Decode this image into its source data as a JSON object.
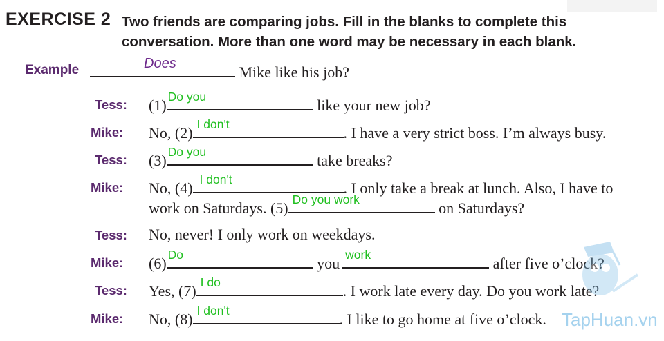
{
  "exercise": {
    "label": "EXERCISE 2",
    "instruction_line1": "Two friends are comparing jobs. Fill in the blanks to complete this",
    "instruction_line2": "conversation. More than one word may be necessary in each blank."
  },
  "example": {
    "label": "Example",
    "answer": "Does",
    "rest": "Mike like his job?"
  },
  "dialogue": [
    {
      "speaker": "Tess:",
      "num": "(1)",
      "answers": [
        "Do you"
      ],
      "after": "like your new job?"
    },
    {
      "speaker": "Mike:",
      "pre": "No,",
      "num": "(2)",
      "answers": [
        "I don't"
      ],
      "after": ". I have a very strict boss. I’m always busy."
    },
    {
      "speaker": "Tess:",
      "num": "(3)",
      "answers": [
        "Do you"
      ],
      "after": "take breaks?"
    },
    {
      "speaker": "Mike:",
      "pre": "No,",
      "num": "(4)",
      "answers": [
        "I don't"
      ],
      "after": ". I only take a break at lunch. Also, I have to",
      "line2_pre": "work on Saturdays.",
      "line2_num": "(5)",
      "line2_answer": "Do you work",
      "line2_after": "on Saturdays?"
    },
    {
      "speaker": "Tess:",
      "text": "No, never! I only work on weekdays."
    },
    {
      "speaker": "Mike:",
      "num": "(6)",
      "answers": [
        "Do",
        "work"
      ],
      "middle": "you",
      "after": "after five o’clock?"
    },
    {
      "speaker": "Tess:",
      "pre": "Yes,",
      "num": "(7)",
      "answers": [
        "I do"
      ],
      "after": ". I work late every day. Do you work late?"
    },
    {
      "speaker": "Mike:",
      "pre": "No,",
      "num": "(8)",
      "answers": [
        "I don't"
      ],
      "after": ". I like to go home at five o’clock."
    }
  ],
  "watermark": {
    "text": "TapHuan.vn",
    "icon": "owl-logo-icon"
  },
  "colors": {
    "speaker": "#5b2a6e",
    "answer": "#1fbf1f",
    "example_answer": "#6e2a8c"
  }
}
